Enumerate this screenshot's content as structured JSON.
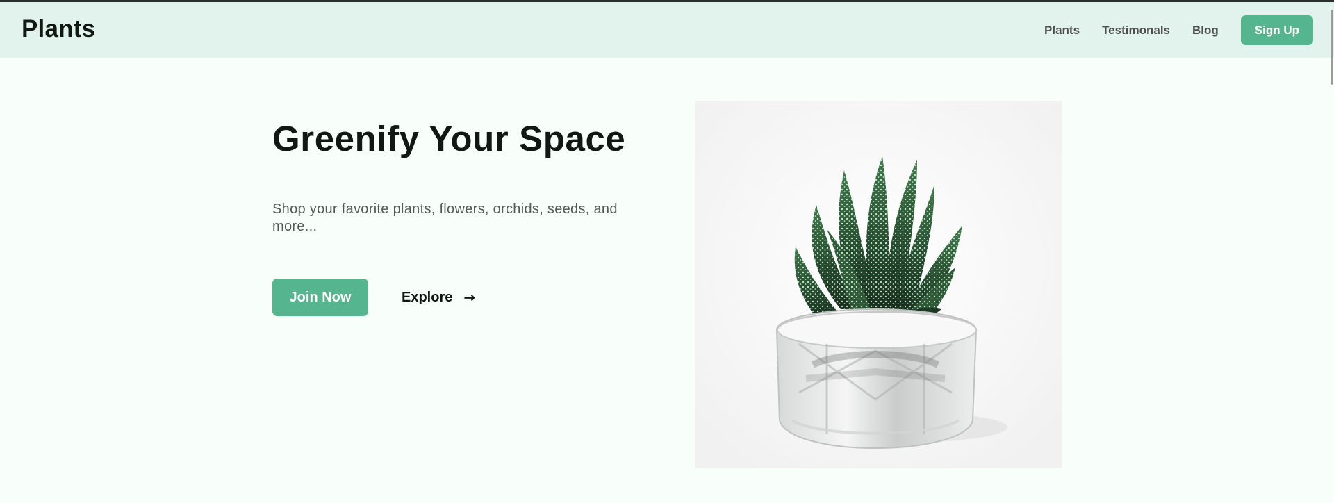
{
  "header": {
    "brand": "Plants",
    "nav": [
      "Plants",
      "Testimonals",
      "Blog"
    ],
    "signup_label": "Sign Up"
  },
  "hero": {
    "title": "Greenify Your Space",
    "subtitle": "Shop your favorite plants, flowers, orchids, seeds, and more...",
    "join_label": "Join Now",
    "explore_label": "Explore",
    "explore_arrow": "→",
    "image_icon": "succulent-plant-image"
  },
  "colors": {
    "accent": "#55b58e",
    "header_bg": "#e1f3ec",
    "page_bg": "#f8fffa",
    "text_dark": "#111713"
  }
}
